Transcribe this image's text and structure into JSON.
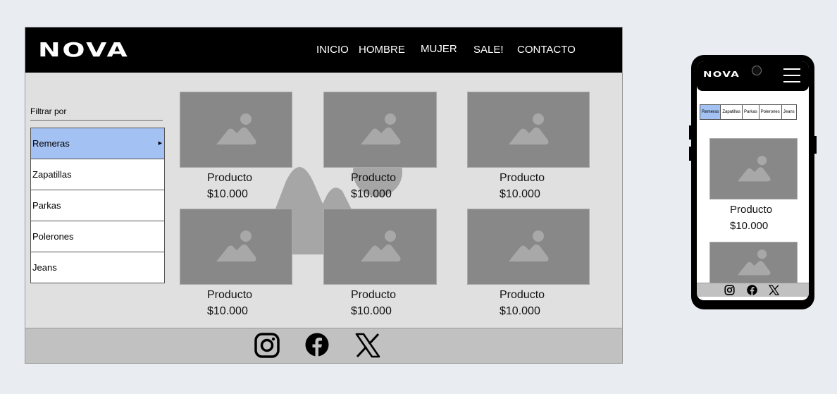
{
  "desktop": {
    "brand": "NOVA",
    "menu": [
      "INICIO",
      "HOMBRE",
      "MUJER",
      "SALE!",
      "CONTACTO"
    ],
    "filter": {
      "title": "Filtrar por",
      "items": [
        "Remeras",
        "Zapatillas",
        "Parkas",
        "Polerones",
        "Jeans"
      ],
      "selected": "Remeras"
    },
    "products": [
      {
        "name": "Producto",
        "price": "$10.000"
      },
      {
        "name": "Producto",
        "price": "$10.000"
      },
      {
        "name": "Producto",
        "price": "$10.000"
      },
      {
        "name": "Producto",
        "price": "$10.000"
      },
      {
        "name": "Producto",
        "price": "$10.000"
      },
      {
        "name": "Producto",
        "price": "$10.000"
      }
    ],
    "social": [
      "instagram-icon",
      "facebook-icon",
      "x-icon"
    ]
  },
  "mobile": {
    "brand": "NOVA",
    "tabs": [
      "Remeras",
      "Zapatillas",
      "Parkas",
      "Polerones",
      "Jeans"
    ],
    "products": [
      {
        "name": "Producto",
        "price": "$10.000"
      }
    ],
    "social": [
      "instagram-icon",
      "facebook-icon",
      "x-icon"
    ]
  },
  "colors": {
    "page_bg": "#e9edf2",
    "nav_bg": "#000000",
    "selected": "#a3c1f2",
    "placeholder": "#888888",
    "footer": "#c1c1c1"
  }
}
